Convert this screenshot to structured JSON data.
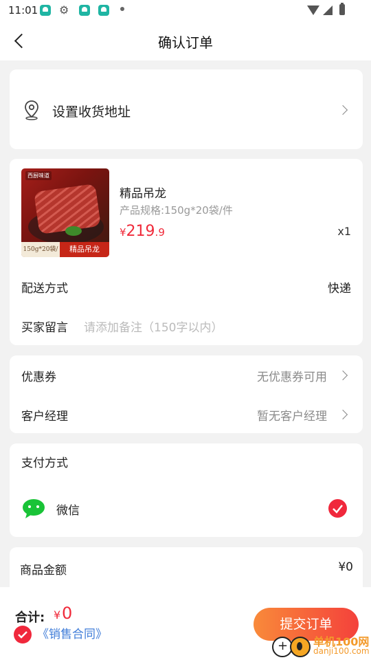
{
  "status_bar": {
    "time": "11:01"
  },
  "header": {
    "title": "确认订单"
  },
  "address": {
    "label": "设置收货地址"
  },
  "product": {
    "name": "精品吊龙",
    "spec": "产品规格:150g*20袋/件",
    "price_currency": "¥",
    "price_int": "219",
    "price_dec": ".9",
    "quantity": "x1",
    "thumb_tag": "150g*20袋/件",
    "thumb_name": "精品吊龙"
  },
  "delivery": {
    "label": "配送方式",
    "value": "快递"
  },
  "note": {
    "label": "买家留言",
    "placeholder": "请添加备注（150字以内）"
  },
  "coupon": {
    "label": "优惠券",
    "value": "无优惠券可用"
  },
  "manager": {
    "label": "客户经理",
    "value": "暂无客户经理"
  },
  "payment": {
    "title": "支付方式",
    "method": "微信"
  },
  "summary": {
    "label": "商品金额",
    "value": "¥0"
  },
  "footer": {
    "total_label": "合计:",
    "total_currency": "¥",
    "total_value": "0",
    "contract": "《销售合同》",
    "submit": "提交订单"
  },
  "watermark": {
    "name": "单机100网",
    "url": "danji100.com"
  },
  "colors": {
    "accent": "#f02a3a",
    "link": "#3f7cd8",
    "wechat": "#19c337"
  }
}
